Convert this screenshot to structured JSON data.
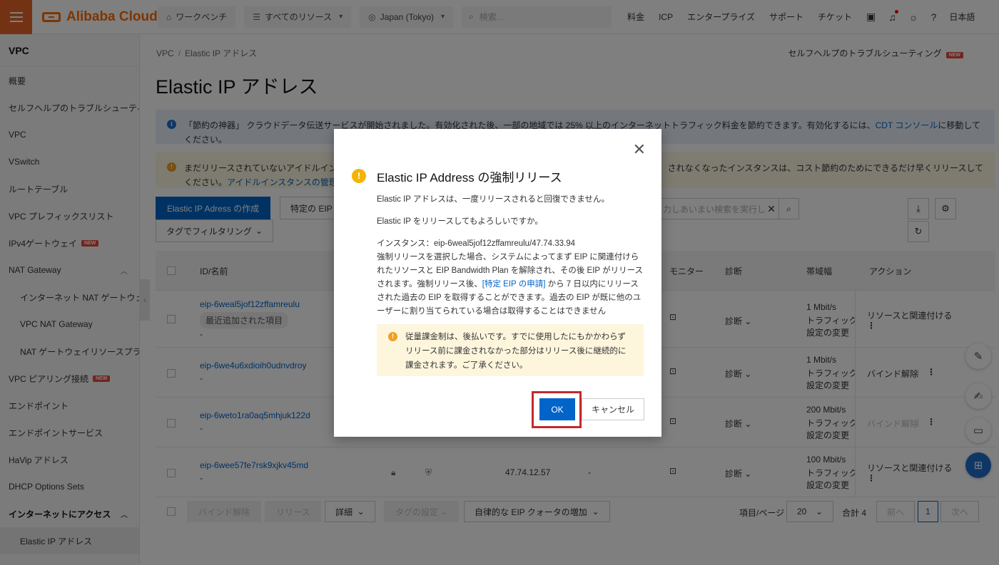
{
  "topbar": {
    "brand": "Alibaba Cloud",
    "workbench": "ワークベンチ",
    "all_resources": "すべてのリソース",
    "region": "Japan (Tokyo)",
    "search_placeholder": "検索...",
    "links": [
      "料金",
      "ICP",
      "エンタープライズ",
      "サポート",
      "チケット"
    ],
    "language": "日本語"
  },
  "sidebar": {
    "title": "VPC",
    "items": [
      {
        "label": "概要"
      },
      {
        "label": "セルフヘルプのトラブルシューティング"
      },
      {
        "label": "VPC"
      },
      {
        "label": "VSwitch"
      },
      {
        "label": "ルートテーブル"
      },
      {
        "label": "VPC プレフィックスリスト"
      },
      {
        "label": "IPv4ゲートウェイ"
      },
      {
        "label": "NAT Gateway"
      },
      {
        "label": "インターネット NAT ゲートウェイ"
      },
      {
        "label": "VPC NAT Gateway"
      },
      {
        "label": "NAT ゲートウェイリソースプラン"
      },
      {
        "label": "VPC ピアリング接続"
      },
      {
        "label": "エンドポイント"
      },
      {
        "label": "エンドポイントサービス"
      },
      {
        "label": "HaVip アドレス"
      },
      {
        "label": "DHCP Options Sets"
      },
      {
        "label": "インターネットにアクセス"
      },
      {
        "label": "Elastic IP アドレス"
      }
    ],
    "new_badge": "NEW"
  },
  "main": {
    "breadcrumb": [
      "VPC",
      "Elastic IP アドレス"
    ],
    "help_link": "セルフヘルプのトラブルシューティング",
    "help_badge": "NEW",
    "title": "Elastic IP アドレス",
    "info_banner": {
      "text": "「節約の神器」 クラウドデータ伝送サービスが開始されました。有効化された後、一部の地域では 25% 以上のインターネットトラフィック料金を節約できます。有効化するには、",
      "link": "CDT コンソール",
      "text2": "に移動してください。"
    },
    "warn_banner": {
      "text_left": "まだリリースされていないアイドルインス",
      "text_right": "されなくなったインスタンスは、コスト節約のためにできるだけ早くリリースして",
      "line2": "ください。",
      "link": "アイドルインスタンスの管理"
    },
    "create_button": "Elastic IP Adress の作成",
    "specific_button": "特定の EIP",
    "tag_filter": "タグでフィルタリング",
    "search_placeholder": "力しあいまい検索を実行して",
    "columns": {
      "id": "ID/名前",
      "monitor": "モニター",
      "diagnosis": "診断",
      "bandwidth": "帯域幅",
      "action": "アクション"
    },
    "rows": [
      {
        "id": "eip-6weal5jof12zffamreulu",
        "tag": "最近追加された項目",
        "sub": "-",
        "ip": "",
        "dash": "",
        "diag": "診断",
        "bw": "1 Mbit/s",
        "bw2": "トラフィック課",
        "bw3": "設定の変更",
        "action": "リソースと関連付ける",
        "action_state": "enabled"
      },
      {
        "id": "eip-6we4u6xdioih0udnvdroy",
        "tag": "",
        "sub": "-",
        "ip": "",
        "dash": "",
        "diag": "診断",
        "bw": "1 Mbit/s",
        "bw2": "トラフィック課",
        "bw3": "設定の変更",
        "action": "バインド解除",
        "action_state": "enabled"
      },
      {
        "id": "eip-6weto1ra0aq5mhjuk122d",
        "tag": "",
        "sub": "-",
        "ip": "",
        "dash": "",
        "diag": "診断",
        "bw": "200 Mbit/s",
        "bw2": "トラフィック課",
        "bw3": "設定の変更",
        "action": "バインド解除",
        "action_state": "disabled"
      },
      {
        "id": "eip-6wee57fe7rsk9xjkv45md",
        "tag": "",
        "sub": "-",
        "ip": "47.74.12.57",
        "dash": "-",
        "diag": "診断",
        "bw": "100 Mbit/s",
        "bw2": "トラフィック課",
        "bw3": "設定の変更",
        "action": "リソースと関連付ける",
        "action_state": "enabled"
      }
    ],
    "footer": {
      "unbind": "バインド解除",
      "release": "リリース",
      "detail": "詳細",
      "tag_settings": "タグの設定",
      "quota": "自律的な EIP クォータの増加",
      "per_page_label": "項目/ページ",
      "per_page_value": "20",
      "total": "合計 4",
      "prev": "前へ",
      "page": "1",
      "next": "次へ"
    }
  },
  "modal": {
    "title": "Elastic IP Address の強制リリース",
    "line1": "Elastic IP アドレスは、一度リリースされると回復できません。",
    "line2": "Elastic IP をリリースしてもよろしいですか。",
    "instance": "インスタンス：eip-6weal5jof12zffamreulu/47.74.33.94",
    "desc_a": "強制リリースを選択した場合、システムによってまず EIP に関連付けられたリソースと EIP Bandwidth Plan を解除され、その後 EIP がリリースされます。強制リリース後、",
    "desc_link": "[特定 EIP の申請]",
    "desc_b": " から 7 日以内にリリースされた過去の EIP を取得することができます。過去の EIP が既に他のユーザーに割り当てられている場合は取得することはできません",
    "note": "従量課金制は、後払いです。すでに使用したにもかかわらずリリース前に課金されなかった部分はリリース後に継続的に課金されます。ご了承ください。",
    "ok": "OK",
    "cancel": "キャンセル"
  },
  "colors": {
    "accent": "#0064c8",
    "brand": "#ff6a00",
    "highlight": "#c4282d",
    "warning": "#f5b400"
  }
}
